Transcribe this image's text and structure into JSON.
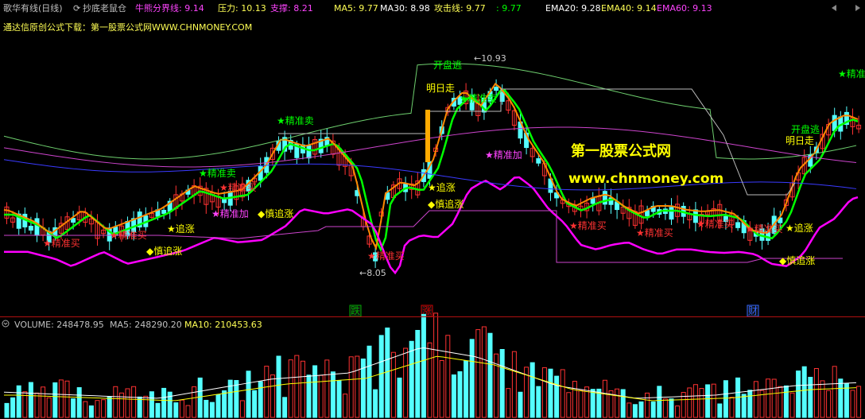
{
  "header": {
    "stock_name": "歌华有线(日线)",
    "indicator_name": "抄底老鼠仓",
    "bull_bear_line": "牛熊分界线: 9.14",
    "resistance": "压力: 10.13",
    "support": "支撑: 8.21",
    "ma5": "MA5: 9.77",
    "ma30": "MA30: 8.98",
    "attack_line": "攻击线: 9.77",
    "extra": ": 9.77",
    "ema20": "EMA20: 9.28",
    "ema40": "EMA40: 9.14",
    "ema60": "EMA60: 9.13"
  },
  "subline": "通达信原创公式下载：第一股票公式网WWW.CHNMONEY.COM",
  "watermark": {
    "title": "第一股票公式网",
    "url": "www.chnmoney.com"
  },
  "price_labels": {
    "high": "10.93",
    "low": "8.05"
  },
  "signal_labels": {
    "precise_buy": "精准买",
    "precise_sell": "精准卖",
    "precise_add": "精准加",
    "chase_up": "追涨",
    "careful_chase": "慎追涨",
    "open_escape": "开盘逃",
    "leave_tomorrow": "明日走"
  },
  "markers": {
    "fall": "跌",
    "rise": "涨",
    "finance": "财"
  },
  "volume": {
    "volume": "VOLUME: 248478.95",
    "ma5": "MA5: 248290.20",
    "ma10": "MA10: 210453.63"
  },
  "colors": {
    "up": "#ff3232",
    "down": "#54ffff",
    "ma_white": "#ffffff",
    "ma_yellow": "#ffff00",
    "ma_magenta": "#ff00ff",
    "green": "#00ff00",
    "blue": "#4444ff",
    "gray": "#c0c0c0"
  }
}
